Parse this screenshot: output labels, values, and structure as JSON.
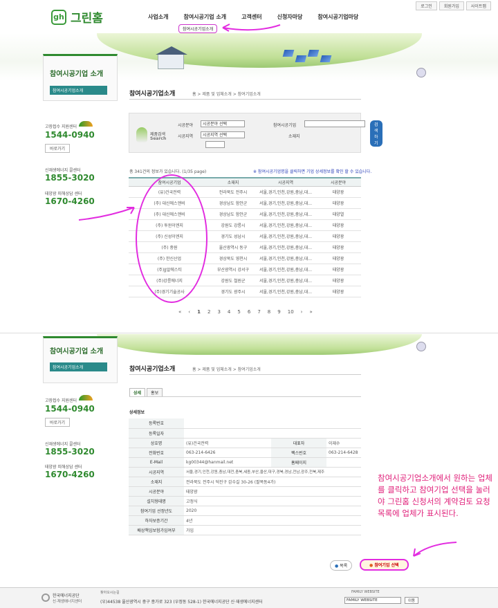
{
  "util": {
    "login": "로그인",
    "join": "회원가입",
    "sitemap": "사이트맵"
  },
  "logo": {
    "mark": "gh",
    "name": "그린홈"
  },
  "gnb": [
    "사업소개",
    "참여시공기업 소개",
    "고객센터",
    "신청자마당",
    "참여시공기업마당"
  ],
  "gnb_sub_active": "참여시공기업소개",
  "sidebar": {
    "title": "참여시공기업 소개",
    "menu": "참여시공기업소개",
    "help1_label": "고장접수 지원센터",
    "help1_phone": "1544-0940",
    "shortcut": "바로가기",
    "help2_label": "신재생에너지 콜센터",
    "help2_phone": "1855-3020",
    "help3_label": "태양광 피해상담 센터",
    "help3_phone": "1670-4260"
  },
  "content": {
    "title": "참여시공기업소개",
    "breadcrumb": "홈 > 제품 및 업체소개 > 참여기업소개"
  },
  "search": {
    "title1": "제품검색",
    "title2": "Search",
    "field_label": "시공분야",
    "field_value": "시공분야 선택",
    "region_label": "시공지역",
    "region_value": "시공지역 선택",
    "company_label": "참여시공기업",
    "address_label": "소재지",
    "button": "검색하기"
  },
  "count_text": "총 341건의 정보가 있습니다. (1/35 page)",
  "notice_text": "※ 참여시공기업명을 클릭하면 기업 상세정보를 확인 할 수 있습니다.",
  "table": {
    "headers": [
      "참여시공기업",
      "소재지",
      "시공지역",
      "시공분야"
    ],
    "rows": [
      [
        "(유)건국전력",
        "전라북도  전주시",
        "서울,경기,인천,강원,충남,대...",
        "태양광"
      ],
      [
        "(주) 대신에스앤비",
        "경상남도  함안군",
        "서울,경기,인천,강원,충남,대...",
        "태양광"
      ],
      [
        "(주) 대신에스앤비",
        "경상남도  함안군",
        "서울,경기,인천,강원,충남,대...",
        "태양열"
      ],
      [
        "(주) 투윈이엔지",
        "강원도  강릉시",
        "서울,경기,인천,강원,충남,대...",
        "태양광"
      ],
      [
        "(주) 신성이엔지",
        "경기도  성남시",
        "서울,경기,인천,강원,충남,대...",
        "태양광"
      ],
      [
        "(주) 중원",
        "울산광역시  동구",
        "서울,경기,인천,강원,충남,대...",
        "태양광"
      ],
      [
        "(주) 한신산업",
        "경상북도  영천시",
        "서울,경기,인천,강원,충남,대...",
        "태양광"
      ],
      [
        "(주)JJ알에스티",
        "부산광역시  강서구",
        "서울,경기,인천,강원,충남,대...",
        "태양광"
      ],
      [
        "(주)강릉에너지",
        "강원도  철원군",
        "서울,경기,인천,강원,충남,대...",
        "태양광"
      ],
      [
        "(주)경기기술공사",
        "경기도  광주시",
        "서울,경기,인천,강원,충남,대...",
        "태양광"
      ]
    ]
  },
  "pager": [
    "1",
    "2",
    "3",
    "4",
    "5",
    "6",
    "7",
    "8",
    "9",
    "10"
  ],
  "detail_tabs": [
    "상세",
    "홍보"
  ],
  "detail_heading": "상세정보",
  "detail": {
    "reg_no_label": "등록번호",
    "reg_date_label": "등록일자",
    "company_label": "상호명",
    "company": "(유)건국전력",
    "ceo_label": "대표자",
    "ceo": "이재수",
    "phone_label": "전화번호",
    "phone": "063-214-6426",
    "fax_label": "팩스번호",
    "fax": "063-214-6428",
    "email_label": "E-Mail",
    "email": "kg00344@hanmail.net",
    "homepage_label": "홈페이지",
    "region_label": "시공지역",
    "region": "서울,경기,인천,강원,충남,대전,충북,세종,부산,울산,대구,경북,경남,전남,광주,전북,제주",
    "address_label": "소재지",
    "address": "전라북도 전주시 덕진구 감수길 30-26 (팔복동4가)",
    "field_label": "시공분야",
    "field": "태양광",
    "install_label": "설치형태명",
    "install": "고정식",
    "year_label": "참여기업 선정년도",
    "year": "2020",
    "warranty_label": "하자보증기간",
    "warranty": "4년",
    "insurance_label": "배상책임보험가입여부",
    "insurance": "가입"
  },
  "buttons": {
    "list": "목록",
    "select": "참여기업 선택"
  },
  "annotation": "참여시공기업소개에서 원하는 업체를 클릭하고 참여기업 선택을 눌러야 그린홈 신청서의 계약검토 요청 목록에 업체가 표시된다.",
  "footer": {
    "org1": "한국에너지공단",
    "org2": "신·재생에너지센터",
    "directions": "찾아오시는길",
    "address": "(우)44538 울산광역시 중구 종가로 323 (우정동 528-1) 한국에너지공단 신·재생에너지센터",
    "family_label": "FAMILY WEBSITE",
    "family_value": "FAMILY WEBSITE",
    "go": "이동"
  },
  "colors": {
    "brand": "#2f8a2f",
    "annotation": "#e22ce0",
    "annotation_text": "#e0207a"
  }
}
